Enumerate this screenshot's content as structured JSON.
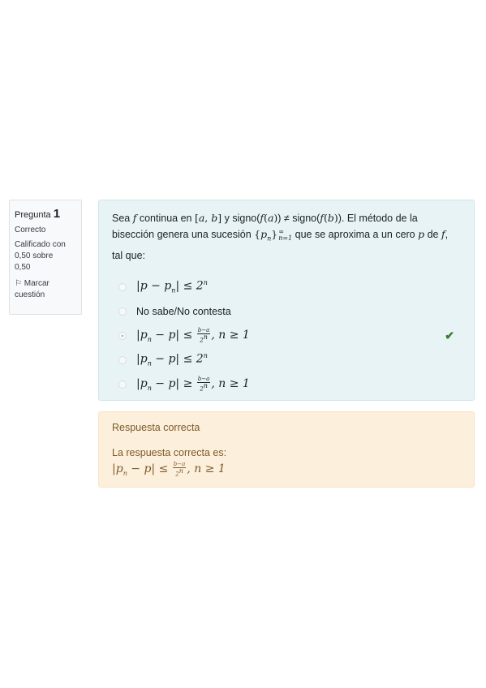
{
  "question_info": {
    "label": "Pregunta",
    "number": "1",
    "state": "Correcto",
    "grade_line1": "Calificado con",
    "grade_line2": "0,50 sobre",
    "grade_line3": "0,50",
    "flag_label_line1": "Marcar",
    "flag_label_line2": "cuestión",
    "flag_icon": "flag-outline-icon"
  },
  "question": {
    "text_parts": {
      "p1": "Sea ",
      "p2": " continua en ",
      "p3": " y signo(",
      "p4": ") ≠ signo(",
      "p5": "). El método de la bisección genera una sucesión ",
      "p6": " que se aproxima a un cero ",
      "p7": " de ",
      "p8": ", tal que:"
    },
    "options": [
      {
        "text": "|p − pₙ| ≤ 2ⁿ",
        "selected": false,
        "correct": false
      },
      {
        "text": "No sabe/No contesta",
        "selected": false,
        "correct": false
      },
      {
        "text": "|pₙ − p| ≤ (b−a)/2ⁿ, n ≥ 1",
        "selected": true,
        "correct": true
      },
      {
        "text": "|pₙ − p| ≤ 2ⁿ",
        "selected": false,
        "correct": false
      },
      {
        "text": "|pₙ − p| ≥ (b−a)/2ⁿ, n ≥ 1",
        "selected": false,
        "correct": false
      }
    ]
  },
  "outcome": {
    "feedback": "Respuesta correcta",
    "right_answer_label": "La respuesta correcta es:",
    "right_answer": "|pₙ − p| ≤ (b−a)/2ⁿ, n ≥ 1"
  },
  "colors": {
    "formulation_bg": "#e7f3f5",
    "outcome_bg": "#fcefdc",
    "correct_check": "#357a32"
  }
}
